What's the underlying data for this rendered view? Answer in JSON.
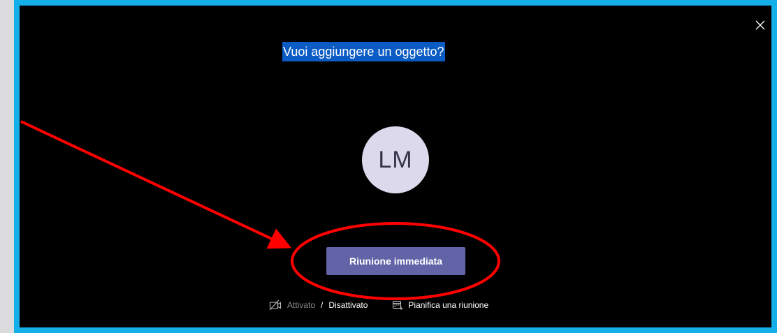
{
  "dialog": {
    "title": "Vuoi aggiungere un oggetto?",
    "close_icon": "close-icon"
  },
  "avatar": {
    "initials": "LM"
  },
  "meet_now": {
    "label": "Riunione immediata"
  },
  "video_toggle": {
    "icon": "video-off-icon",
    "on_label": "Attivato",
    "separator": "/",
    "off_label": "Disattivato"
  },
  "schedule": {
    "icon": "calendar-add-icon",
    "label": "Pianifica una riunione"
  },
  "colors": {
    "frame_border": "#14aee8",
    "background": "#000000",
    "title_highlight": "#0a5bc4",
    "button": "#6264a7",
    "avatar_bg": "#dcd9ec",
    "annotation": "#ff0000"
  }
}
